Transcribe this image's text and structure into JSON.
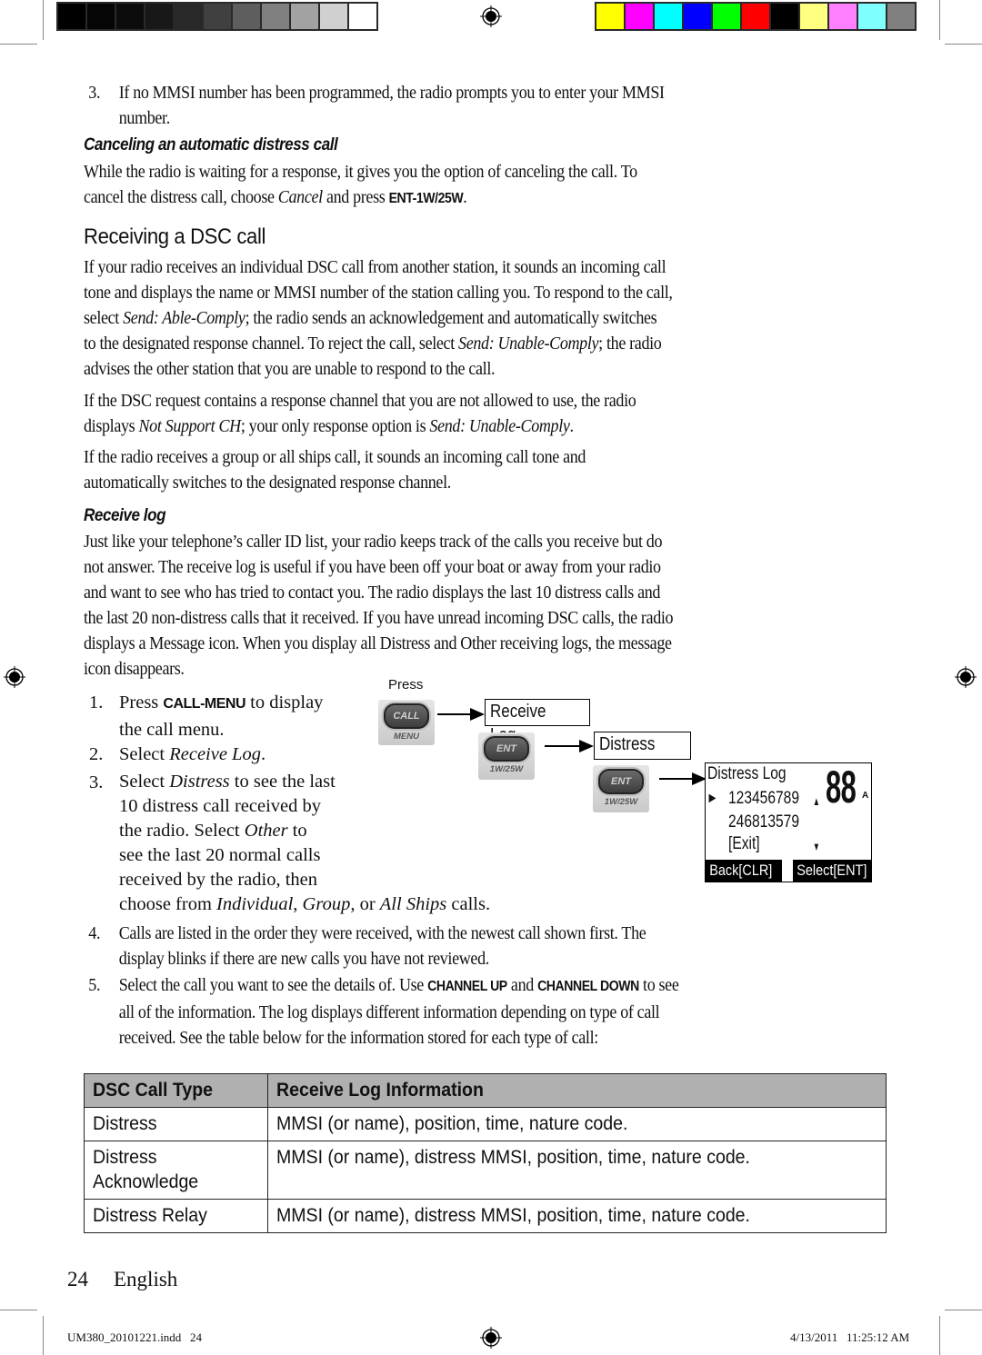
{
  "print_marks": {
    "grayscale_bar": [
      "#000000",
      "#050505",
      "#0c0c0c",
      "#181818",
      "#282828",
      "#404040",
      "#5e5e5e",
      "#808080",
      "#a2a2a2",
      "#d0d0d0",
      "#ffffff"
    ],
    "color_bar": [
      "#ffff00",
      "#ff00ff",
      "#00ffff",
      "#0000ff",
      "#00ff00",
      "#ff0000",
      "#000000",
      "#ffff80",
      "#ff80ff",
      "#80ffff",
      "#808080"
    ],
    "slug_file": "UM380_20101221.indd   24",
    "slug_timestamp": "4/13/2011   11:25:12 AM"
  },
  "intro_item": {
    "number": "3.",
    "line1": "If no MMSI number has been programmed, the radio prompts you to enter your MMSI",
    "line2": "number."
  },
  "cancel_section": {
    "heading": "Canceling an automatic distress call",
    "line1": "While the radio is waiting for a response, it gives you the option of canceling the call. To",
    "line2_pre": "cancel the distress call, choose ",
    "line2_italic": "Cancel",
    "line2_mid": " and press ",
    "line2_key": "ENT-1W/25W",
    "line2_post": "."
  },
  "receiving_section": {
    "heading": "Receiving a DSC call",
    "p1": {
      "l1": "If your radio receives an individual DSC call from another station, it sounds an incoming call",
      "l2": "tone and displays the name or MMSI number of the station calling you. To respond to the call,",
      "l3_pre": "select ",
      "l3_italic": "Send: Able-Comply",
      "l3_post": "; the radio sends an acknowledgement and automatically switches",
      "l4_pre": "to the designated response channel. To reject the call, select ",
      "l4_italic": "Send: Unable-Comply",
      "l4_post": "; the radio",
      "l5": "advises the other station that you are unable to respond to the call."
    },
    "p2": {
      "l1": "If the DSC request contains a response channel that you are not allowed to use, the radio",
      "l2_pre": "displays ",
      "l2_italic1": "Not Support CH",
      "l2_mid": "; your only response option is ",
      "l2_italic2": "Send: Unable-Comply",
      "l2_post": "."
    },
    "p3": {
      "l1": "If the radio receives a group or all ships call, it sounds an incoming call tone and",
      "l2": "automatically switches to the designated response channel."
    }
  },
  "receive_log_section": {
    "heading": "Receive log",
    "lines": [
      "Just like your telephone’s caller ID list, your radio keeps track of the calls you receive but do",
      "not answer. The receive log is useful if you have been off your boat or away from your radio",
      "and want to see who has tried to contact you. The radio displays the last 10 distress calls and",
      "the last 20 non-distress calls that it received. If you have unread incoming DSC calls, the radio",
      "displays a Message icon. When you display all Distress and Other receiving logs, the message",
      "icon disappears."
    ],
    "steps": {
      "s1": {
        "number": "1.",
        "pre": "Press ",
        "key": "CALL-MENU",
        "post": " to display",
        "l2": "the call menu."
      },
      "s2": {
        "number": "2.",
        "pre": "Select ",
        "italic": "Receive Log",
        "post": "."
      },
      "s3": {
        "number": "3.",
        "l1_pre": "Select ",
        "l1_italic": "Distress",
        "l1_post": " to see the last",
        "l2": "10 distress call received by",
        "l3_pre": "the radio. Select ",
        "l3_italic": "Other",
        "l3_post": " to",
        "l4": "see the last 20 normal calls",
        "l5": "received by the radio, then",
        "l6_pre": "choose from ",
        "l6_i1": "Individual",
        "l6_c1": ", ",
        "l6_i2": "Group,",
        "l6_c2": " or ",
        "l6_i3": "All Ships",
        "l6_post": " calls."
      },
      "s4": {
        "number": "4.",
        "l1": "Calls are listed in the order they were received, with the newest call shown first. The",
        "l2": "display blinks if there are new calls you have not reviewed."
      },
      "s5": {
        "number": "5.",
        "l1_pre": "Select the call you want to see the details of. Use ",
        "l1_key1": "CHANNEL UP",
        "l1_mid": " and ",
        "l1_key2": "CHANNEL DOWN",
        "l1_post": " to see",
        "l2": "all of the information. The log displays different information depending on type of call",
        "l3": "received. See the table below for the information stored for each type of call:"
      }
    }
  },
  "diagram": {
    "press_label": "Press",
    "call_button": {
      "cap": "CALL",
      "sub": "MENU"
    },
    "ent_button_1": {
      "cap": "ENT",
      "sub": "1W/25W"
    },
    "ent_button_2": {
      "cap": "ENT",
      "sub": "1W/25W"
    },
    "menu_receive_log": "Receive Log",
    "menu_distress": "Distress",
    "lcd": {
      "title": "Distress Log",
      "channel": "88",
      "channel_suffix": "A",
      "entries": [
        "123456789",
        "246813579"
      ],
      "exit": "[Exit]",
      "up_arrow": "▲",
      "down_arrow": "▼",
      "pointer": "►",
      "softkey_left": "Back[CLR]",
      "softkey_right": "Select[ENT]"
    }
  },
  "table": {
    "headers": [
      "DSC Call Type",
      "Receive Log Information"
    ],
    "rows": [
      {
        "type": "Distress",
        "type2": "",
        "info": "MMSI (or name), position, time, nature code."
      },
      {
        "type": "Distress",
        "type2": "Acknowledge",
        "info": "MMSI (or name), distress MMSI, position, time, nature code."
      },
      {
        "type": "Distress Relay",
        "type2": "",
        "info": "MMSI (or name), distress MMSI, position, time, nature code."
      }
    ]
  },
  "footer": {
    "page_number": "24",
    "language": "English"
  }
}
